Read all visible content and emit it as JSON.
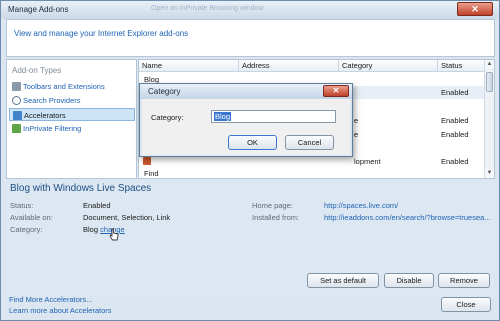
{
  "window": {
    "title": "Manage Add-ons",
    "ghost_title": "Open an InPrivate Browsing window",
    "close_glyph": "✕"
  },
  "header": {
    "text": "View and manage your Internet Explorer add-ons"
  },
  "addon_types": {
    "heading": "Add-on Types",
    "items": [
      {
        "label": "Toolbars and Extensions",
        "icon": "gear-icon",
        "selected": false
      },
      {
        "label": "Search Providers",
        "icon": "search-icon",
        "selected": false
      },
      {
        "label": "Accelerators",
        "icon": "accelerator-icon",
        "selected": true
      },
      {
        "label": "InPrivate Filtering",
        "icon": "inprivate-icon",
        "selected": false
      }
    ]
  },
  "list": {
    "columns": [
      "Name",
      "Address",
      "Category",
      "Status"
    ],
    "group_top": "Blog",
    "rows": [
      {
        "name": "",
        "address": "",
        "category": "",
        "status": "Enabled"
      },
      {
        "name": "",
        "address": "",
        "category": "",
        "status": ""
      },
      {
        "name": "",
        "address": "",
        "category": "e",
        "status": "Enabled"
      },
      {
        "name": "",
        "address": "",
        "category": "e",
        "status": "Enabled"
      },
      {
        "name": "",
        "address": "",
        "category": "",
        "status": ""
      },
      {
        "name": "",
        "address": "",
        "category": "lopment",
        "status": "Enabled"
      }
    ],
    "group_bottom": "Find"
  },
  "details": {
    "title": "Blog with Windows Live Spaces",
    "status_label": "Status:",
    "status_value": "Enabled",
    "available_label": "Available on:",
    "available_value": "Document, Selection, Link",
    "category_label": "Category:",
    "category_value": "Blog",
    "change_link": "change",
    "homepage_label": "Home page:",
    "homepage_value": "http://spaces.live.com/",
    "installed_label": "Installed from:",
    "installed_value": "http://ieaddons.com/en/search/?browse=truesea..."
  },
  "buttons": {
    "set_default": "Set as default",
    "disable": "Disable",
    "remove": "Remove",
    "close": "Close"
  },
  "footer": {
    "find_more": "Find More Accelerators...",
    "learn_more": "Learn more about Accelerators"
  },
  "dialog": {
    "title": "Category",
    "label": "Category:",
    "value": "Blog",
    "ok": "OK",
    "cancel": "Cancel",
    "close_glyph": "✕"
  }
}
